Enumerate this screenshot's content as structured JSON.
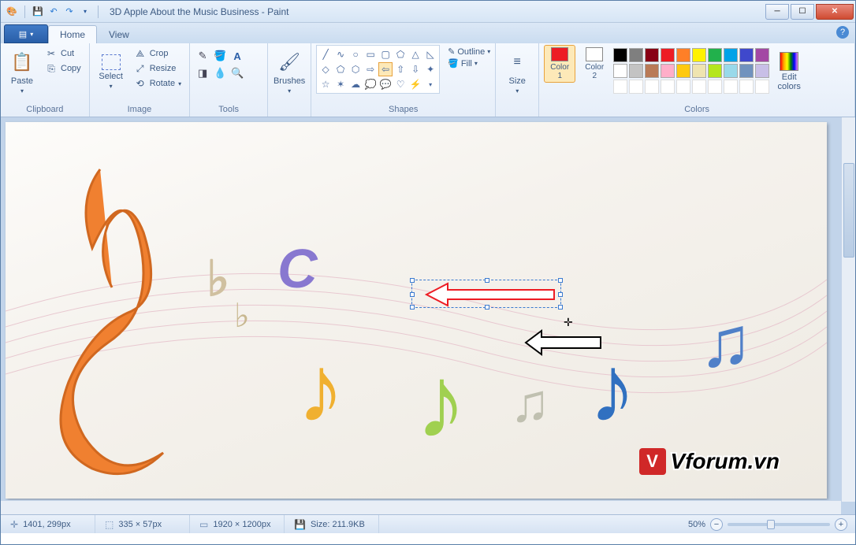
{
  "window": {
    "title": "3D Apple About the Music Business - Paint"
  },
  "tabs": {
    "home": "Home",
    "view": "View"
  },
  "ribbon": {
    "clipboard": {
      "label": "Clipboard",
      "paste": "Paste",
      "cut": "Cut",
      "copy": "Copy"
    },
    "image": {
      "label": "Image",
      "select": "Select",
      "crop": "Crop",
      "resize": "Resize",
      "rotate": "Rotate"
    },
    "tools": {
      "label": "Tools"
    },
    "brushes": {
      "label": "Brushes",
      "btn": "Brushes"
    },
    "shapes": {
      "label": "Shapes",
      "outline": "Outline",
      "fill": "Fill"
    },
    "size": {
      "label": "Size",
      "btn": "Size"
    },
    "colors": {
      "label": "Colors",
      "c1": "Color\n1",
      "c2": "Color\n2",
      "edit": "Edit\ncolors"
    }
  },
  "palette_colors": [
    "#000000",
    "#7f7f7f",
    "#880015",
    "#ed1c24",
    "#ff7f27",
    "#fff200",
    "#22b14c",
    "#00a2e8",
    "#3f48cc",
    "#a349a4",
    "#ffffff",
    "#c3c3c3",
    "#b97a57",
    "#ffaec9",
    "#ffc90e",
    "#efe4b0",
    "#b5e61d",
    "#99d9ea",
    "#7092be",
    "#c8bfe7"
  ],
  "color1": "#ed1c24",
  "color2": "#ffffff",
  "status": {
    "pos": "1401, 299px",
    "sel": "335 × 57px",
    "dim": "1920 × 1200px",
    "size": "Size: 211.9KB",
    "zoom": "50%"
  },
  "watermark": {
    "badge": "V",
    "text": "Vforum.vn"
  }
}
